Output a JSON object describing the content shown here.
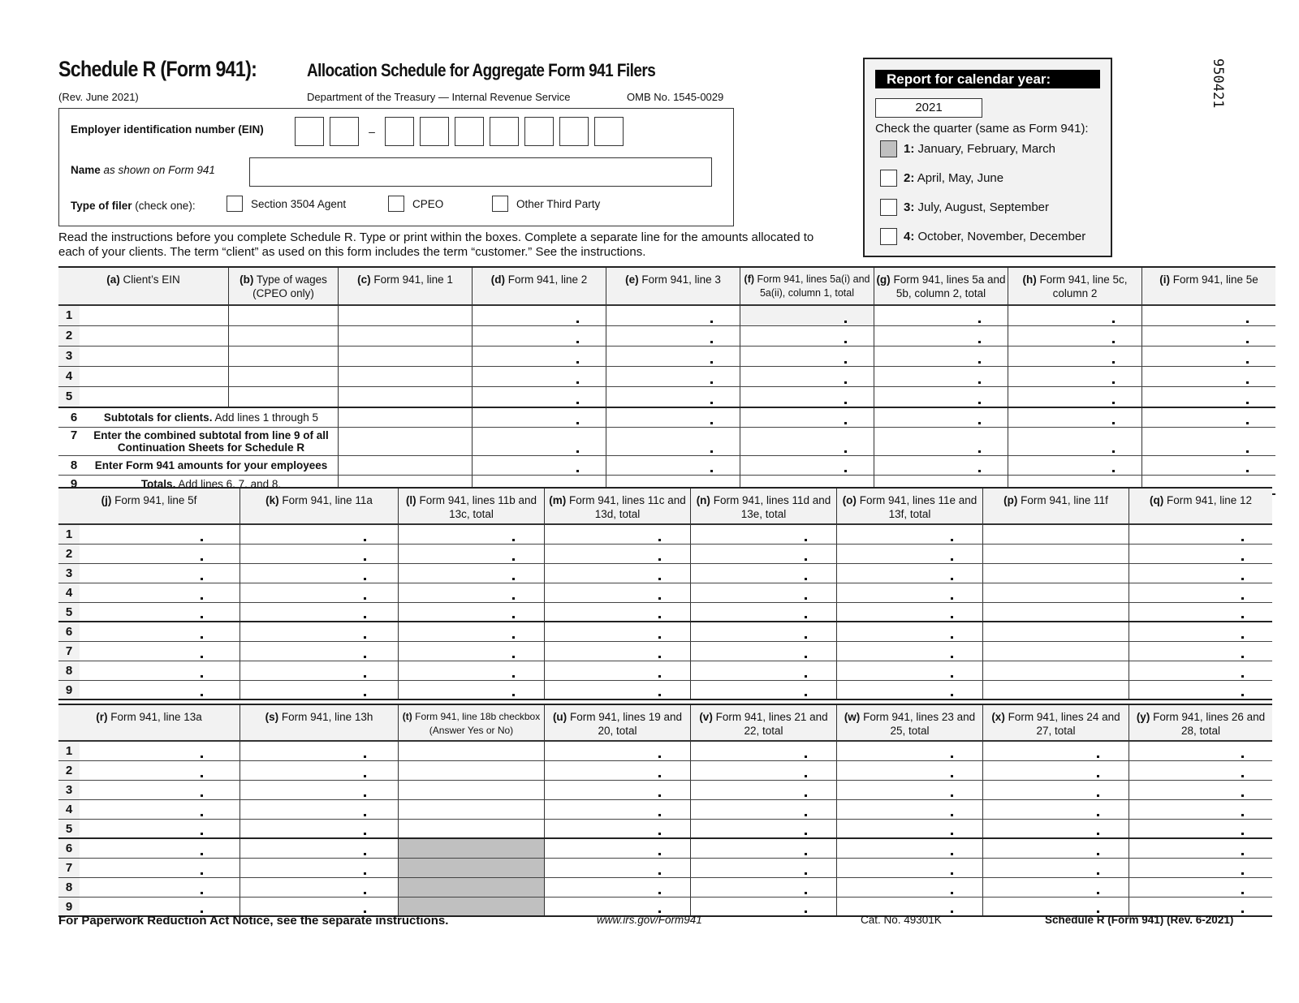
{
  "header": {
    "title": "Schedule R (Form 941):",
    "subtitle": "Allocation Schedule for Aggregate Form 941 Filers",
    "revision": "(Rev. June 2021)",
    "department": "Department of the Treasury — Internal Revenue Service",
    "omb": "OMB No. 1545-0029",
    "barcode_number": "950421"
  },
  "identification": {
    "ein_label": "Employer identification number (EIN)",
    "ein_dash": "–",
    "ein_prefix_digits": [
      "",
      ""
    ],
    "ein_suffix_digits": [
      "",
      "",
      "",
      "",
      "",
      "",
      ""
    ],
    "name_label_bold": "Name",
    "name_label_italic": "as shown on Form 941",
    "name_value": "",
    "filer_label_bold": "Type of filer",
    "filer_label_rest": "(check one):",
    "filer_options": [
      {
        "label": "Section 3504 Agent",
        "checked": false
      },
      {
        "label": "CPEO",
        "checked": false
      },
      {
        "label": "Other Third Party",
        "checked": false
      }
    ]
  },
  "calendar": {
    "bar_label": "Report for calendar year:",
    "year": "2021",
    "quarter_label": "Check the quarter (same as Form 941):",
    "quarters": [
      {
        "num": "1:",
        "label": "January, February, March",
        "checked": true
      },
      {
        "num": "2:",
        "label": "April, May, June",
        "checked": false
      },
      {
        "num": "3:",
        "label": "July, August, September",
        "checked": false
      },
      {
        "num": "4:",
        "label": "October, November, December",
        "checked": false
      }
    ]
  },
  "instructions": "Read the instructions before you complete Schedule R. Type or print within the boxes. Complete a separate line for the amounts allocated to each of your clients. The term “client” as used on this form includes the term “customer.” See the instructions.",
  "table1": {
    "columns": [
      {
        "letter": "(a)",
        "text": "Client’s EIN"
      },
      {
        "letter": "(b)",
        "text": "Type of wages (CPEO only)"
      },
      {
        "letter": "(c)",
        "text": "Form 941, line 1"
      },
      {
        "letter": "(d)",
        "text": "Form 941, line 2"
      },
      {
        "letter": "(e)",
        "text": "Form 941, line 3"
      },
      {
        "letter": "(f)",
        "text": "Form 941, lines 5a(i) and 5a(ii), column 1, total"
      },
      {
        "letter": "(g)",
        "text": "Form 941, lines 5a and 5b, column 2, total"
      },
      {
        "letter": "(h)",
        "text": "Form 941, line 5c, column 2"
      },
      {
        "letter": "(i)",
        "text": "Form 941, line 5e"
      }
    ],
    "rows": [
      "1",
      "2",
      "3",
      "4",
      "5"
    ],
    "summary_rows": [
      {
        "num": "6",
        "bold": "Subtotals for clients.",
        "text": " Add lines 1 through 5"
      },
      {
        "num": "7",
        "bold": "Enter the combined subtotal from line 9 of all Continuation Sheets for Schedule R",
        "text": ""
      },
      {
        "num": "8",
        "bold": "Enter Form 941 amounts for your employees",
        "text": ""
      },
      {
        "num": "9",
        "bold": "Totals.",
        "text": " Add lines 6, 7, and 8."
      }
    ]
  },
  "table2": {
    "columns": [
      {
        "letter": "(j)",
        "text": "Form 941, line 5f"
      },
      {
        "letter": "(k)",
        "text": "Form 941, line 11a"
      },
      {
        "letter": "(l)",
        "text": "Form 941, lines 11b and 13c, total"
      },
      {
        "letter": "(m)",
        "text": "Form 941, lines 11c and 13d, total"
      },
      {
        "letter": "(n)",
        "text": "Form 941, lines 11d and 13e, total"
      },
      {
        "letter": "(o)",
        "text": "Form 941, lines 11e and 13f, total"
      },
      {
        "letter": "(p)",
        "text": "Form 941, line 11f"
      },
      {
        "letter": "(q)",
        "text": "Form 941, line 12"
      }
    ],
    "rows": [
      "1",
      "2",
      "3",
      "4",
      "5",
      "6",
      "7",
      "8",
      "9"
    ]
  },
  "table3": {
    "columns": [
      {
        "letter": "(r)",
        "text": "Form 941, line 13a"
      },
      {
        "letter": "(s)",
        "text": "Form 941, line 13h"
      },
      {
        "letter": "(t)",
        "text": "Form 941, line 18b checkbox (Answer Yes or No)"
      },
      {
        "letter": "(u)",
        "text": "Form 941, lines 19 and 20, total"
      },
      {
        "letter": "(v)",
        "text": "Form 941, lines 21 and 22, total"
      },
      {
        "letter": "(w)",
        "text": "Form 941, lines 23 and 25, total"
      },
      {
        "letter": "(x)",
        "text": "Form 941, lines 24 and 27, total"
      },
      {
        "letter": "(y)",
        "text": "Form 941, lines 26 and 28, total"
      }
    ],
    "rows": [
      "1",
      "2",
      "3",
      "4",
      "5",
      "6",
      "7",
      "8",
      "9"
    ]
  },
  "footer": {
    "paperwork": "For Paperwork Reduction Act Notice, see the separate instructions.",
    "url": "www.irs.gov/Form941",
    "cat": "Cat. No. 49301K",
    "form_id": "Schedule R (Form 941) (Rev. 6-2021)"
  }
}
